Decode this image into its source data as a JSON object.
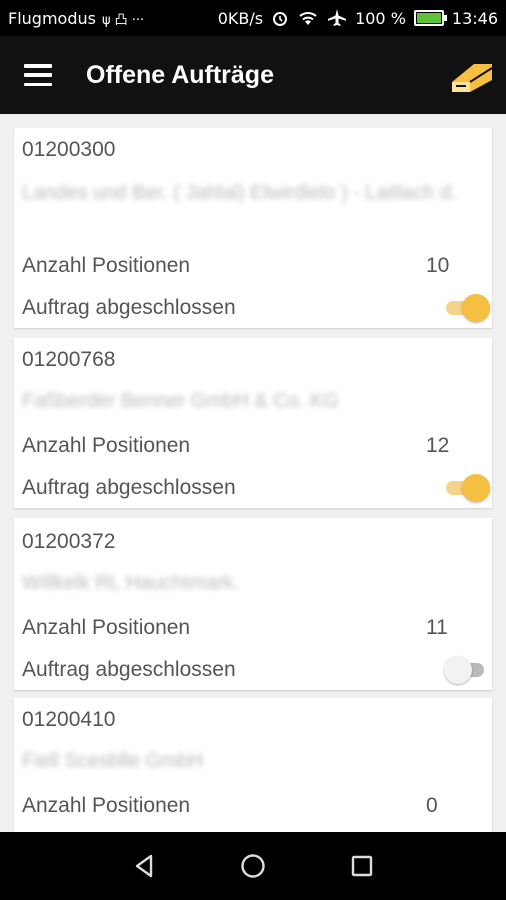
{
  "status_bar": {
    "carrier": "Flugmodus",
    "notif_icons": "ψ 凸 ···",
    "net_speed": "0KB/s",
    "battery_percent": "100 %",
    "battery_level": 1.0,
    "time": "13:46"
  },
  "app_bar": {
    "title": "Offene Aufträge",
    "menu_icon": "hamburger-menu-icon",
    "action_icon": "eraser-icon",
    "accent_color": "#f5c042",
    "background_color": "#111111"
  },
  "orders": [
    {
      "id": "01200300",
      "customer_blurred": "Landes und Ber. ( Jahlal) Elwirdlelo ) - Laitlach d.",
      "positions_label": "Anzahl Positionen",
      "positions": "10",
      "completed_label": "Auftrag abgeschlossen",
      "completed": true
    },
    {
      "id": "01200768",
      "customer_blurred": "Faßberder Benner GmbH & Co. KG",
      "positions_label": "Anzahl Positionen",
      "positions": "12",
      "completed_label": "Auftrag abgeschlossen",
      "completed": true
    },
    {
      "id": "01200372",
      "customer_blurred": "Willkelk RL Hauchtmark.",
      "positions_label": "Anzahl Positionen",
      "positions": "11",
      "completed_label": "Auftrag abgeschlossen",
      "completed": false
    },
    {
      "id": "01200410",
      "customer_blurred": "Fiell Scesblle GmbH",
      "positions_label": "Anzahl Positionen",
      "positions": "0"
    }
  ],
  "nav_bar": {
    "back_icon": "back-triangle-icon",
    "home_icon": "home-circle-icon",
    "recents_icon": "recents-square-icon"
  }
}
